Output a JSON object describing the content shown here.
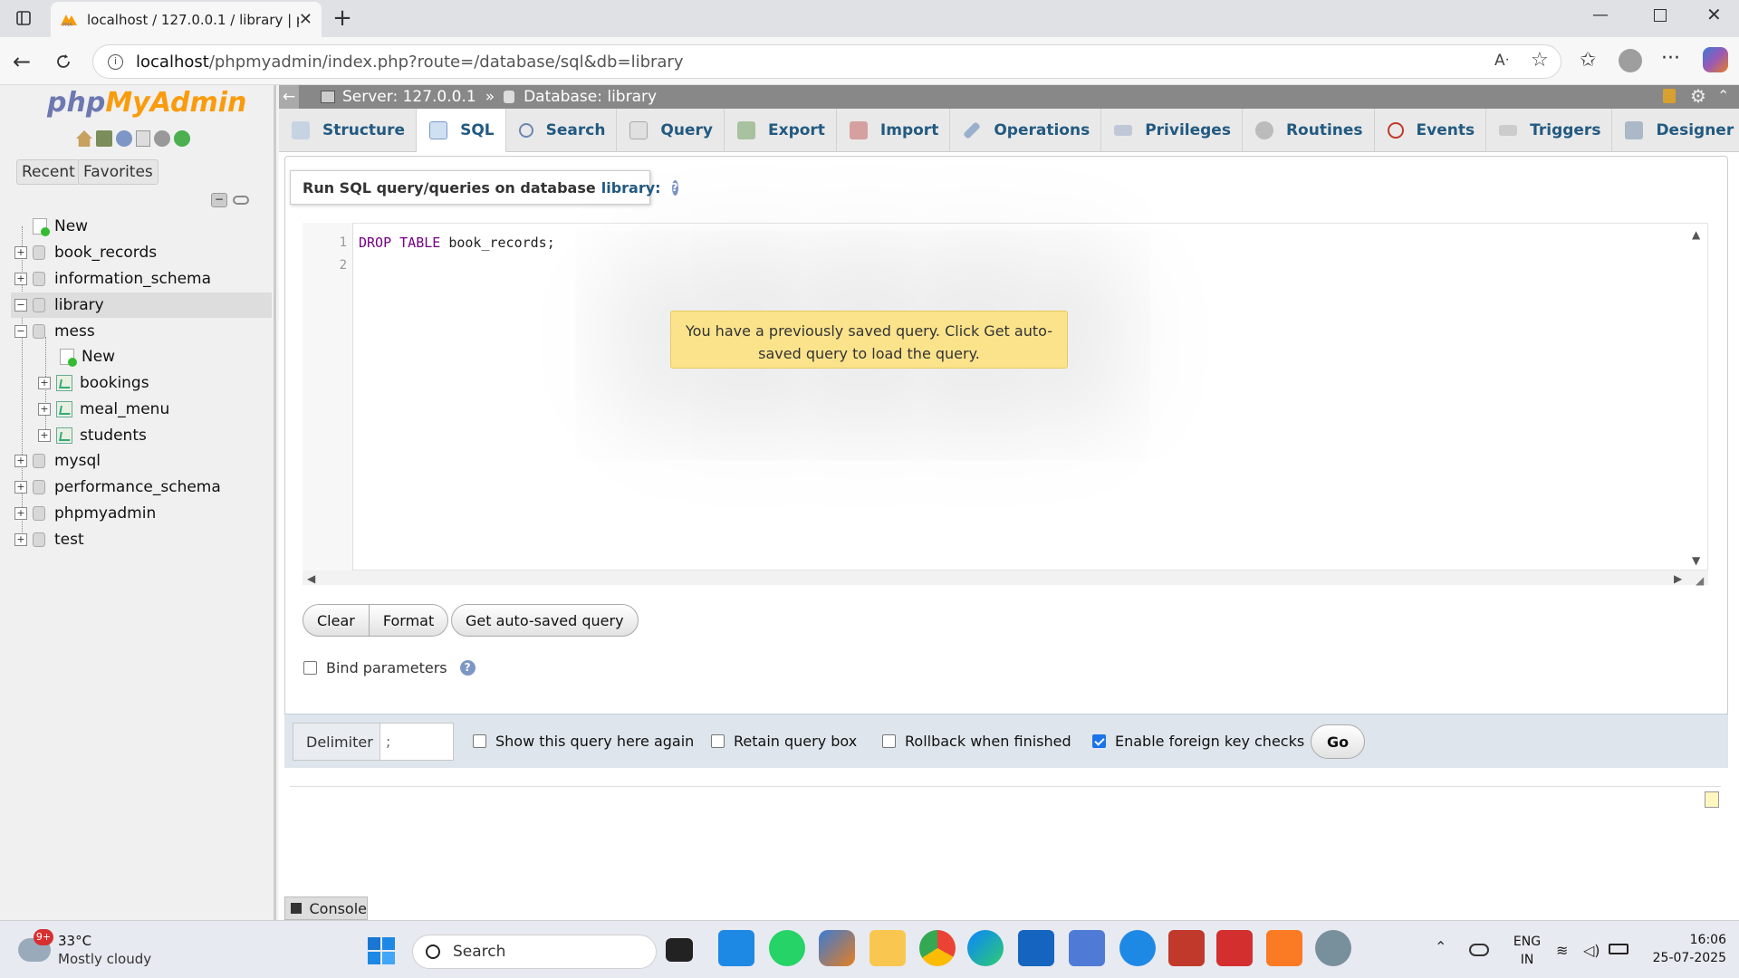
{
  "browser": {
    "tab_title": "localhost / 127.0.0.1 / library | php",
    "url_host": "localhost",
    "url_path": "/phpmyadmin/index.php?route=/database/sql&db=library"
  },
  "pma": {
    "logo_php": "php",
    "logo_my": "MyAdmin",
    "nav_recent": "Recent",
    "nav_favorites": "Favorites",
    "tree": {
      "new": "New",
      "book_records": "book_records",
      "information_schema": "information_schema",
      "library": "library",
      "mess": "mess",
      "mess_new": "New",
      "bookings": "bookings",
      "meal_menu": "meal_menu",
      "students": "students",
      "mysql": "mysql",
      "performance_schema": "performance_schema",
      "phpmyadmin": "phpmyadmin",
      "test": "test"
    },
    "breadcrumb": {
      "server": "Server: 127.0.0.1",
      "sep": "»",
      "database": "Database: library"
    },
    "tabs": {
      "structure": "Structure",
      "sql": "SQL",
      "search": "Search",
      "query": "Query",
      "export": "Export",
      "import": "Import",
      "operations": "Operations",
      "privileges": "Privileges",
      "routines": "Routines",
      "events": "Events",
      "triggers": "Triggers",
      "designer": "Designer"
    },
    "legend_text": "Run SQL query/queries on database",
    "legend_db": "library:",
    "editor": {
      "line1": "1",
      "line2": "2",
      "kw1": "DROP",
      "kw2": "TABLE",
      "ident": "book_records;"
    },
    "toast": "You have a previously saved query. Click Get auto-saved query to load the query.",
    "buttons": {
      "clear": "Clear",
      "format": "Format",
      "autosaved": "Get auto-saved query",
      "go": "Go"
    },
    "bind_parameters": "Bind parameters",
    "delimiter_label": "Delimiter",
    "delimiter_value": ";",
    "show_query_again": "Show this query here again",
    "retain_box": "Retain query box",
    "rollback": "Rollback when finished",
    "foreign_keys": "Enable foreign key checks",
    "console": "Console"
  },
  "taskbar": {
    "weather_badge": "9+",
    "temp": "33°C",
    "condition": "Mostly cloudy",
    "search_placeholder": "Search",
    "lang_top": "ENG",
    "lang_bottom": "IN",
    "time": "16:06",
    "date": "25-07-2025"
  },
  "colors": {
    "pma_blue": "#235a81",
    "toast_yellow": "#fbe38c",
    "crumb_gray": "#888888"
  }
}
